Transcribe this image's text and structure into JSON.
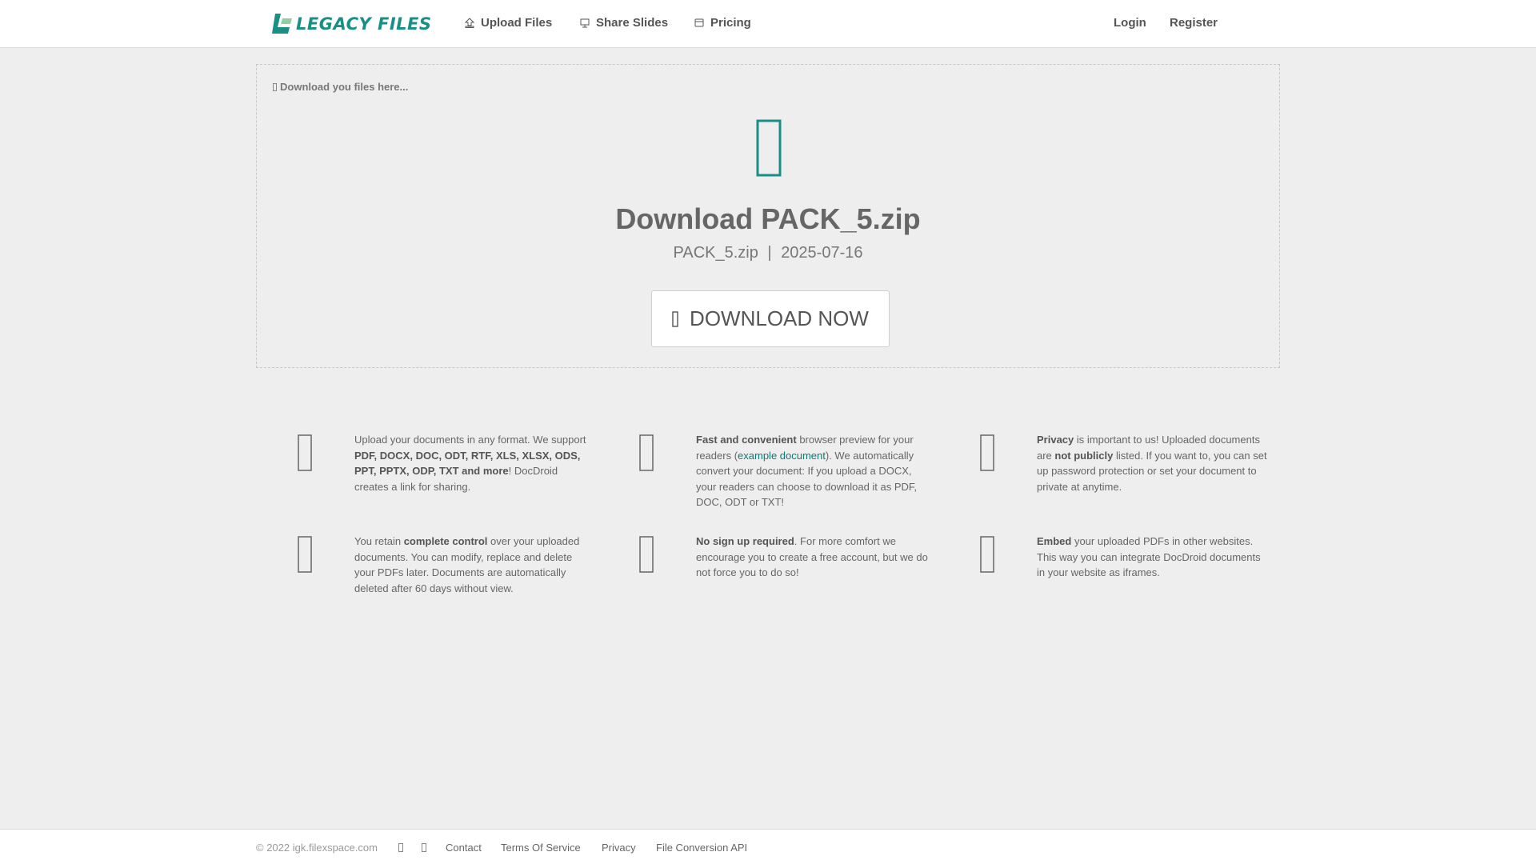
{
  "brand": {
    "logo_text": "LEGACY FILES",
    "accent_color": "#1a8f87"
  },
  "nav": {
    "items": [
      {
        "label": "Upload Files",
        "icon": "upload-icon"
      },
      {
        "label": "Share Slides",
        "icon": "slides-icon"
      },
      {
        "label": "Pricing",
        "icon": "pricing-icon"
      }
    ],
    "login_label": "Login",
    "register_label": "Register"
  },
  "panel": {
    "hint": "Download you files here...",
    "icon": "file-icon",
    "title": "Download PACK_5.zip",
    "filename": "PACK_5.zip",
    "separator": "|",
    "date": "2025-07-16",
    "button_label": "DOWNLOAD NOW",
    "button_icon": "download-icon"
  },
  "features": [
    {
      "icon": "upload-document-icon",
      "parts": [
        "Upload your documents in any format. We support ",
        "PDF, DOCX, DOC, ODT, RTF, XLS, XLSX, ODS, PPT, PPTX, ODP, TXT and more",
        "! DocDroid creates a link for sharing."
      ]
    },
    {
      "icon": "preview-icon",
      "parts": [
        "Fast and convenient",
        " browser preview for your readers (",
        "example document",
        "). We automatically convert your document: If you upload a DOCX, your readers can choose to download it as PDF, DOC, ODT or TXT!"
      ]
    },
    {
      "icon": "privacy-icon",
      "parts": [
        "Privacy",
        " is important to us! Uploaded documents are ",
        "not publicly",
        " listed. If you want to, you can set up password protection or set your document to private at anytime."
      ]
    },
    {
      "icon": "control-icon",
      "parts": [
        "You retain ",
        "complete control",
        " over your uploaded documents. You can modify, replace and delete your PDFs later. Documents are automatically deleted after 60 days without view."
      ]
    },
    {
      "icon": "no-signup-icon",
      "parts": [
        "No sign up required",
        ". For more comfort we encourage you to create a free account, but we do not force you to do so!"
      ]
    },
    {
      "icon": "embed-icon",
      "parts": [
        "Embed",
        " your uploaded PDFs in other websites. This way you can integrate DocDroid documents in your website as iframes."
      ]
    }
  ],
  "footer": {
    "copyright": "© 2022 igk.filexspace.com",
    "social_icons": [
      "social-icon-1",
      "social-icon-2"
    ],
    "links": [
      "Contact",
      "Terms Of Service",
      "Privacy",
      "File Conversion API"
    ]
  }
}
